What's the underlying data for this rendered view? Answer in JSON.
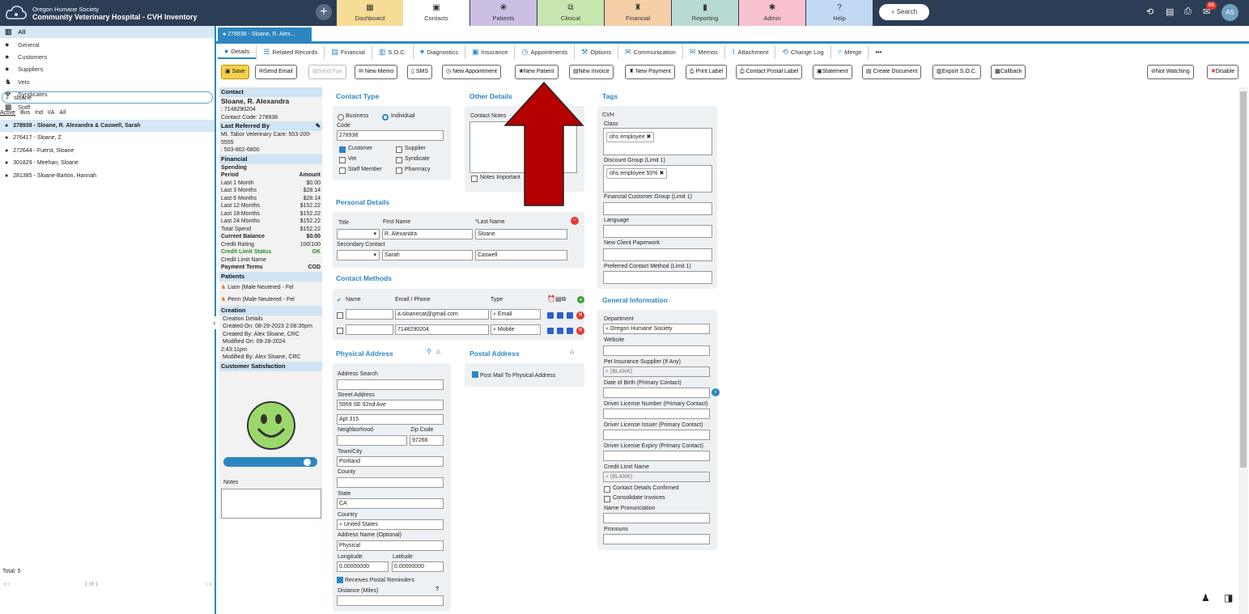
{
  "header": {
    "org": "Oregon Humane Society",
    "app_title": "Community Veterinary Hospital - CVH Inventory",
    "nav": [
      {
        "label": "Dashboard",
        "icon": "dashboard-icon",
        "color": "#f7dc96"
      },
      {
        "label": "Contacts",
        "icon": "contacts-icon",
        "color": "#ffffff"
      },
      {
        "label": "Patients",
        "icon": "paw-icon",
        "color": "#cbbfe3"
      },
      {
        "label": "Clinical",
        "icon": "clinical-icon",
        "color": "#c8e6b0"
      },
      {
        "label": "Financial",
        "icon": "financial-icon",
        "color": "#f5cfa8"
      },
      {
        "label": "Reporting",
        "icon": "bar-chart-icon",
        "color": "#b7dbd2"
      },
      {
        "label": "Admin",
        "icon": "gear-icon",
        "color": "#f7c1cf"
      },
      {
        "label": "Help",
        "icon": "help-icon",
        "color": "#c1d9f3"
      }
    ],
    "search_label": "Search",
    "mail_badge": "66",
    "avatar_initials": "AS"
  },
  "left": {
    "categories": [
      "All",
      "General",
      "Customers",
      "Suppliers",
      "Vets",
      "Syndicates",
      "Staff"
    ],
    "search_value": "sloane",
    "filters": [
      "Active",
      "Bus",
      "Ind",
      "I/A",
      "All"
    ],
    "results": [
      "278938 - Sloane, R. Alexandra & Caswell, Sarah",
      "276417 - Sloane, Z",
      "272644 - Fuerst, Sloane",
      "301829 - Meehan, Sloane",
      "281385 - Sloane-Barton, Hannah"
    ],
    "total": "Total: 5",
    "pager": "1 of 1"
  },
  "record_tab": "278938 - Sloane, R. Alex...",
  "subtabs": [
    "Details",
    "Related Records",
    "Financial",
    "S.O.C.",
    "Diagnostics",
    "Insurance",
    "Appointments",
    "Options",
    "Communication",
    "Memos",
    "Attachment",
    "Change Log",
    "Merge",
    "•••"
  ],
  "toolbar": [
    "Save",
    "Send Email",
    "Send Fax",
    "New Memo",
    "SMS",
    "New Appointment",
    "New Patient",
    "New Invoice",
    "New Payment",
    "Print Label",
    "Contact Postal Label",
    "Statement",
    "Create Document",
    "Export S.O.C.",
    "Callback"
  ],
  "toolbar_right": [
    "Not Watching",
    "Disable"
  ],
  "summary": {
    "contact_hdr": "Contact",
    "name": "Sloane, R. Alexandra",
    "phone": ": 7148290204",
    "code": "Contact Code: 278938",
    "referred_hdr": "Last Referred By",
    "referred": "Mt. Tabor Veterinary Care: 503-200-5555",
    "referred_phone": ": 503-802-6800",
    "financial_hdr": "Financial",
    "spending": "Spending",
    "period_hdr": "Period",
    "amount_hdr": "Amount",
    "spend_rows": [
      [
        "Last 1 Month",
        "$0.00"
      ],
      [
        "Last 3 Months",
        "$28.14"
      ],
      [
        "Last 6 Months",
        "$28.14"
      ],
      [
        "Last 12 Months",
        "$152.22"
      ],
      [
        "Last 18 Months",
        "$152.22"
      ],
      [
        "Last 24 Months",
        "$152.22"
      ],
      [
        "Total Spend",
        "$152.22"
      ]
    ],
    "current_balance": [
      "Current Balance",
      "$0.00"
    ],
    "credit_rating": [
      "Credit Rating",
      "100/100"
    ],
    "credit_status": [
      "Credit Limit Status",
      "OK"
    ],
    "credit_limit_name": "Credit Limit Name",
    "payment_terms": [
      "Payment Terms",
      "COD"
    ],
    "patients_hdr": "Patients",
    "patients": [
      "Liam (Male Neutered - Fel",
      "Penn (Male Neutered - Fel"
    ],
    "creation_hdr": "Creation",
    "creation_lines": [
      "Creation Details",
      "Created On: 08-29-2023 2:08:35pm",
      "Created By: Alex Sloane, CRC",
      "Modified On: 09-28-2024",
      "2:43:11pm",
      "Modified By: Alex Sloane, CRC"
    ],
    "satisfaction_hdr": "Customer Satisfaction",
    "notes_label": "Notes"
  },
  "contact_type": {
    "title": "Contact Type",
    "business": "Business",
    "individual": "Individual",
    "code_label": "Code",
    "code": "278938",
    "checks": [
      "Customer",
      "Supplier",
      "Vet",
      "Syndicate",
      "Staff Member",
      "Pharmacy"
    ]
  },
  "other_details": {
    "title": "Other Details",
    "notes_label": "Contact Notes",
    "important": "Notes Important"
  },
  "personal": {
    "title": "Personal Details",
    "title_lbl": "Title",
    "first_lbl": "First Name",
    "last_lbl": "*Last Name",
    "first": "R. Alexandra",
    "last": "Sloane",
    "secondary_lbl": "Secondary Contact",
    "sec_first": "Sarah",
    "sec_last": "Caswell"
  },
  "methods": {
    "title": "Contact Methods",
    "name_hdr": "Name",
    "email_hdr": "Email / Phone",
    "type_hdr": "Type",
    "rows": [
      {
        "value": "a.sloanecat@gmail.com",
        "type": "Email"
      },
      {
        "value": "7148290204",
        "type": "Mobile"
      }
    ]
  },
  "physical": {
    "title": "Physical Address",
    "search_lbl": "Address Search",
    "street_lbl": "Street Address",
    "street": "5959 SE 92nd Ave",
    "street2": "Apt 315",
    "neighborhood_lbl": "Neighborhood",
    "zip_lbl": "Zip Code",
    "zip": "97266",
    "town_lbl": "Town/City",
    "town": "Portland",
    "county_lbl": "County",
    "state_lbl": "State",
    "state": "CA",
    "country_lbl": "Country",
    "country": "United States",
    "addrname_lbl": "Address Name (Optional)",
    "addrname": "Physical",
    "lon_lbl": "Longitude",
    "lat_lbl": "Latitude",
    "lon": "0.00000000",
    "lat": "0.00000000",
    "reminders": "Receives Postal Reminders",
    "distance_lbl": "Distance (Miles)"
  },
  "postal": {
    "title": "Postal Address",
    "post_mail": "Post Mail To Physical Address"
  },
  "tags": {
    "title": "Tags",
    "cvh": "CVH",
    "class_lbl": "Class",
    "class_chip": "ohs employee",
    "discount_lbl": "Discount Group (Limit 1)",
    "discount_chip": "ohs employee 50%",
    "fin_group_lbl": "Financial Customer Group (Limit 1)",
    "language_lbl": "Language",
    "paperwork_lbl": "New Client Paperwork",
    "preferred_lbl": "Preferred Contact Method (Limit 1)"
  },
  "general": {
    "title": "General Information",
    "department_lbl": "Department",
    "department": "Oregon Humane Society",
    "website_lbl": "Website",
    "insurance_lbl": "Pet Insurance Supplier (If Any)",
    "insurance": "(BLANK)",
    "dob_lbl": "Date of Birth (Primary Contact)",
    "dl_num_lbl": "Driver License Number (Primary Contact)",
    "dl_issuer_lbl": "Driver License Issuer (Primary Contact)",
    "dl_expiry_lbl": "Driver License Expiry (Primary Contact)",
    "credit_limit_lbl": "Credit Limit Name",
    "credit_limit": "(BLANK)",
    "confirmed": "Contact Details Confirmed",
    "consolidate": "Consolidate Invoices",
    "pronunciation_lbl": "Name Pronunciation",
    "pronouns_lbl": "Pronouns"
  },
  "colors": {
    "accent": "#2e86c1",
    "topbar": "#2c3e55",
    "arrow": "#b50000"
  }
}
